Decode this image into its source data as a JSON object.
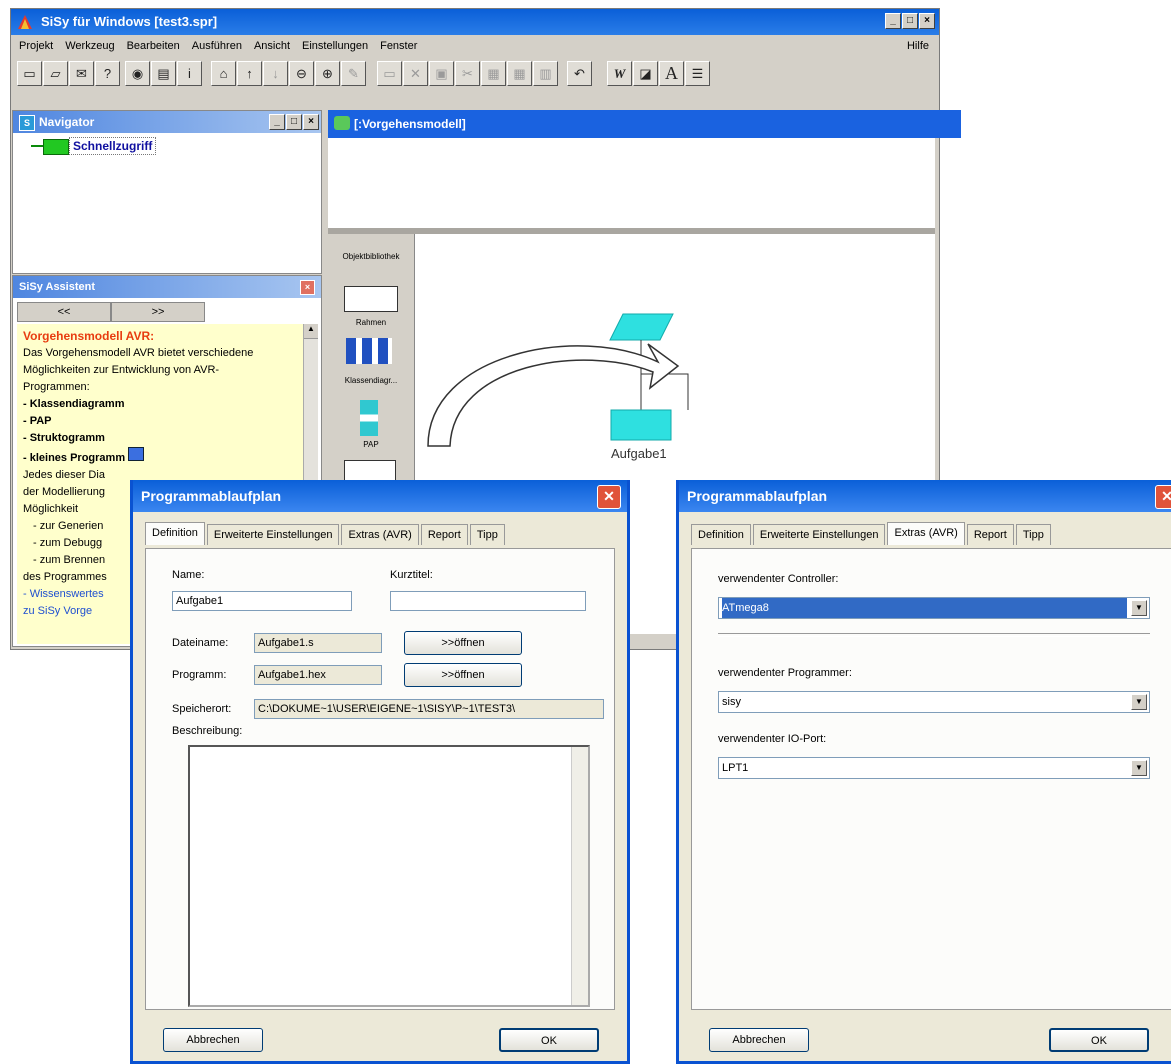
{
  "main_window": {
    "title": "SiSy für Windows [test3.spr]",
    "menu": [
      "Projekt",
      "Werkzeug",
      "Bearbeiten",
      "Ausführen",
      "Ansicht",
      "Einstellungen",
      "Fenster"
    ],
    "help": "Hilfe"
  },
  "navigator": {
    "title": "Navigator",
    "item": "Schnellzugriff"
  },
  "assistant": {
    "title": "SiSy Assistent",
    "back": "<<",
    "forward": ">>",
    "heading": "Vorgehensmodell AVR:",
    "intro": "Das Vorgehensmodell AVR bietet verschiedene Möglichkeiten zur Entwicklung von AVR-Programmen:",
    "bullets": [
      "- Klassendiagramm",
      "- PAP",
      "- Struktogramm",
      "- kleines Programm"
    ],
    "text2": "Jedes dieser Dia",
    "text3": "der Modellierung",
    "text4": "Möglichkeit",
    "sub1": "- zur Generien",
    "sub2": "- zum Debugg",
    "sub3": "- zum Brennen",
    "text5": "des Programmes",
    "link": "- Wissenswertes",
    "link2": "zu SiSy Vorge"
  },
  "document": {
    "title": "[:Vorgehensmodell]"
  },
  "palette": {
    "header": "Objektbibliothek",
    "items": [
      "Rahmen",
      "Klassendiagr...",
      "PAP"
    ]
  },
  "diagram": {
    "task_label": "Aufgabe1"
  },
  "dialog_left": {
    "title": "Programmablaufplan",
    "tabs": [
      "Definition",
      "Erweiterte Einstellungen",
      "Extras (AVR)",
      "Report",
      "Tipp"
    ],
    "name_label": "Name:",
    "name_value": "Aufgabe1",
    "short_label": "Kurztitel:",
    "short_value": "",
    "file_label": "Dateiname:",
    "file_value": "Aufgabe1.s",
    "prog_label": "Programm:",
    "prog_value": "Aufgabe1.hex",
    "open1": ">>öffnen",
    "open2": ">>öffnen",
    "loc_label": "Speicherort:",
    "loc_value": "C:\\DOKUME~1\\USER\\EIGENE~1\\SISY\\P~1\\TEST3\\",
    "desc_label": "Beschreibung:",
    "cancel": "Abbrechen",
    "ok": "OK"
  },
  "dialog_right": {
    "title": "Programmablaufplan",
    "tabs": [
      "Definition",
      "Erweiterte Einstellungen",
      "Extras (AVR)",
      "Report",
      "Tipp"
    ],
    "controller_label": "verwendenter Controller:",
    "controller_value": "ATmega8",
    "programmer_label": "verwendenter Programmer:",
    "programmer_value": "sisy",
    "port_label": "verwendenter IO-Port:",
    "port_value": "LPT1",
    "cancel": "Abbrechen",
    "ok": "OK"
  },
  "colors": {
    "titlebar": "#0a5fd8",
    "assistant_bg": "#ffffcc",
    "assistant_heading": "#e83c10",
    "diagram_shape": "#2ee0e0"
  },
  "icons": [
    "app-icon",
    "new-icon",
    "open-icon",
    "mail-icon",
    "help-icon",
    "binoculars-icon",
    "home-icon",
    "zoom-in-icon",
    "zoom-out-icon",
    "bold-w-icon",
    "font-icon"
  ]
}
